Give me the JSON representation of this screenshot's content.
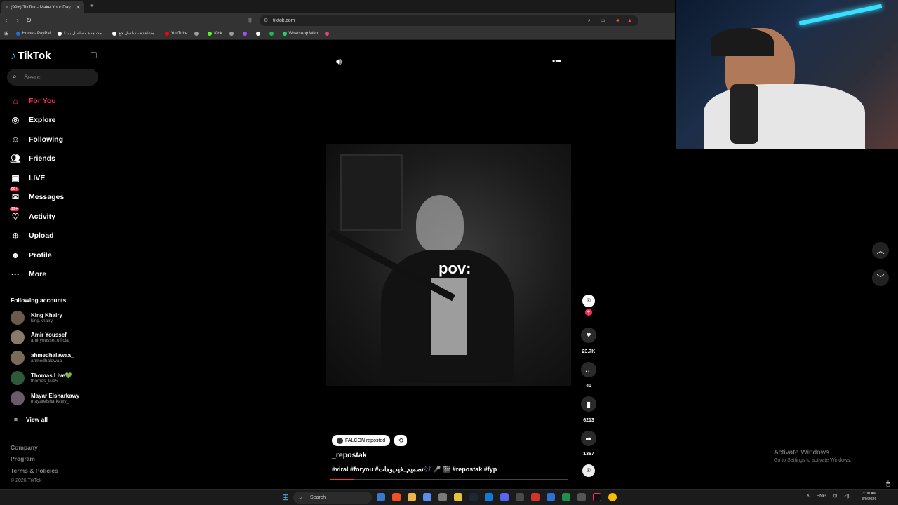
{
  "browser": {
    "tab_title": "(99+) TikTok - Make Your Day",
    "url": "tiktok.com",
    "bookmarks": [
      {
        "label": "Home - PayPal",
        "color": "#1f6fd1"
      },
      {
        "label": "مشاهدة مسلسل بابا ا...",
        "color": "#ffffff"
      },
      {
        "label": "مشاهدة مسلسل جع...",
        "color": "#ffffff"
      },
      {
        "label": "YouTube",
        "color": "#ff0000"
      },
      {
        "label": "",
        "color": "#9e9e9e"
      },
      {
        "label": "Kick",
        "color": "#53fc18"
      },
      {
        "label": "",
        "color": "#9e9e9e"
      },
      {
        "label": "",
        "color": "#a64dff"
      },
      {
        "label": "",
        "color": "#ffffff"
      },
      {
        "label": "",
        "color": "#1db954"
      },
      {
        "label": "WhatsApp Web",
        "color": "#25d366"
      },
      {
        "label": "",
        "color": "#e0457b"
      }
    ]
  },
  "sidebar": {
    "logo": "TikTok",
    "search_placeholder": "Search",
    "nav": [
      {
        "label": "For You",
        "icon": "home-icon",
        "active": true
      },
      {
        "label": "Explore",
        "icon": "compass-icon"
      },
      {
        "label": "Following",
        "icon": "following-icon"
      },
      {
        "label": "Friends",
        "icon": "friends-icon"
      },
      {
        "label": "LIVE",
        "icon": "live-icon"
      },
      {
        "label": "Messages",
        "icon": "messages-icon",
        "badge": "99+"
      },
      {
        "label": "Activity",
        "icon": "activity-icon",
        "badge": "99+"
      },
      {
        "label": "Upload",
        "icon": "upload-icon"
      },
      {
        "label": "Profile",
        "icon": "profile-icon"
      },
      {
        "label": "More",
        "icon": "more-icon"
      }
    ],
    "following_title": "Following accounts",
    "accounts": [
      {
        "name": "King Khairy",
        "handle": "king.khairy"
      },
      {
        "name": "Amir Youssef",
        "handle": "amiryoussef.official"
      },
      {
        "name": "ahmedhalawaa_",
        "handle": "ahmedhalawaa_"
      },
      {
        "name": "Thomas Live💚",
        "handle": "thomas_live5"
      },
      {
        "name": "Mayar Elsharkawy",
        "handle": "mayarelsharkawy_"
      }
    ],
    "view_all": "View all",
    "footer": [
      "Company",
      "Program",
      "Terms & Policies"
    ],
    "copyright": "© 2026 TikTok"
  },
  "video": {
    "overlay_text": "pov:",
    "reposted_by": "FALCON reposted",
    "author": "_repostak",
    "caption": "#viral #foryou #تصميم_فيديوهات🎶 🎤 🎬 #repostak #fyp",
    "progress": 0.1,
    "likes": "23.7K",
    "comments": "40",
    "saves": "6213",
    "shares": "1367"
  },
  "system": {
    "activate_title": "Activate Windows",
    "activate_sub": "Go to Settings to activate Windows.",
    "taskbar_search": "Search",
    "lang": "ENG",
    "time": "3:00 AM",
    "date": "8/9/2026"
  }
}
